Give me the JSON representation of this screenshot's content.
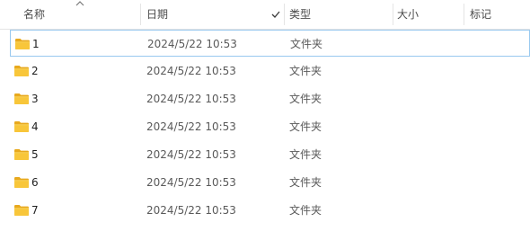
{
  "columns": {
    "name": "名称",
    "date": "日期",
    "type": "类型",
    "size": "大小",
    "tags": "标记"
  },
  "sort": {
    "column": "name",
    "direction": "ascending"
  },
  "rows": [
    {
      "name": "1",
      "date": "2024/5/22 10:53",
      "type": "文件夹",
      "size": "",
      "tags": ""
    },
    {
      "name": "2",
      "date": "2024/5/22 10:53",
      "type": "文件夹",
      "size": "",
      "tags": ""
    },
    {
      "name": "3",
      "date": "2024/5/22 10:53",
      "type": "文件夹",
      "size": "",
      "tags": ""
    },
    {
      "name": "4",
      "date": "2024/5/22 10:53",
      "type": "文件夹",
      "size": "",
      "tags": ""
    },
    {
      "name": "5",
      "date": "2024/5/22 10:53",
      "type": "文件夹",
      "size": "",
      "tags": ""
    },
    {
      "name": "6",
      "date": "2024/5/22 10:53",
      "type": "文件夹",
      "size": "",
      "tags": ""
    },
    {
      "name": "7",
      "date": "2024/5/22 10:53",
      "type": "文件夹",
      "size": "",
      "tags": ""
    }
  ],
  "icons": {
    "folder": "folder-icon",
    "sort": "sort-ascending-icon",
    "check": "check-icon"
  },
  "colors": {
    "folder": "#f8c63a",
    "focus_border": "#99c9ef"
  }
}
